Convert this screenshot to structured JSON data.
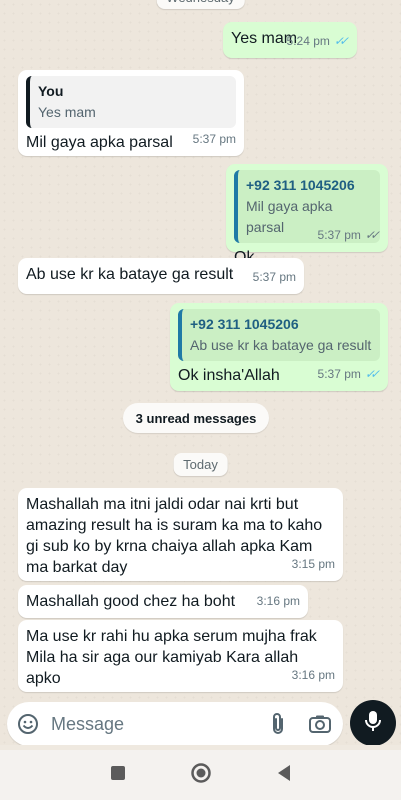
{
  "day_top": "Wednesday",
  "messages": [
    {
      "text": "Yes mam",
      "time": "5:24 pm"
    },
    {
      "quote_author": "You",
      "quote_text": "Yes mam",
      "text": "Mil gaya apka parsal",
      "time": "5:37 pm"
    },
    {
      "quote_author": "+92 311 1045206",
      "quote_text": "Mil gaya apka parsal",
      "text": "Ok",
      "time": "5:37 pm"
    },
    {
      "text": "Ab use kr ka bataye ga result",
      "time": "5:37 pm"
    },
    {
      "quote_author": "+92 311 1045206",
      "quote_text": "Ab use kr ka bataye ga result",
      "text": "Ok insha'Allah",
      "time": "5:37 pm"
    },
    {
      "text": "Mashallah ma itni jaldi odar nai krti but amazing result ha is suram ka ma to kaho gi sub ko by krna chaiya allah apka Kam ma barkat day",
      "time": "3:15 pm"
    },
    {
      "text": "Mashallah good chez ha boht",
      "time": "3:16 pm"
    },
    {
      "text": "Ma use kr rahi hu apka serum mujha frak Mila ha sir aga our kamiyab Kara allah apko",
      "time": "3:16 pm"
    }
  ],
  "unread_label": "3 unread messages",
  "day_today": "Today",
  "composer": {
    "placeholder": "Message"
  },
  "icons": {
    "emoji": "emoji-icon",
    "attach": "paperclip-icon",
    "camera": "camera-icon",
    "mic": "mic-icon",
    "nav_recents": "square-icon",
    "nav_home": "circle-icon",
    "nav_back": "triangle-back-icon"
  },
  "colors": {
    "outgoing": "#d9fdd3",
    "incoming": "#ffffff",
    "read_tick": "#53bdeb",
    "background": "#ede6dc"
  }
}
